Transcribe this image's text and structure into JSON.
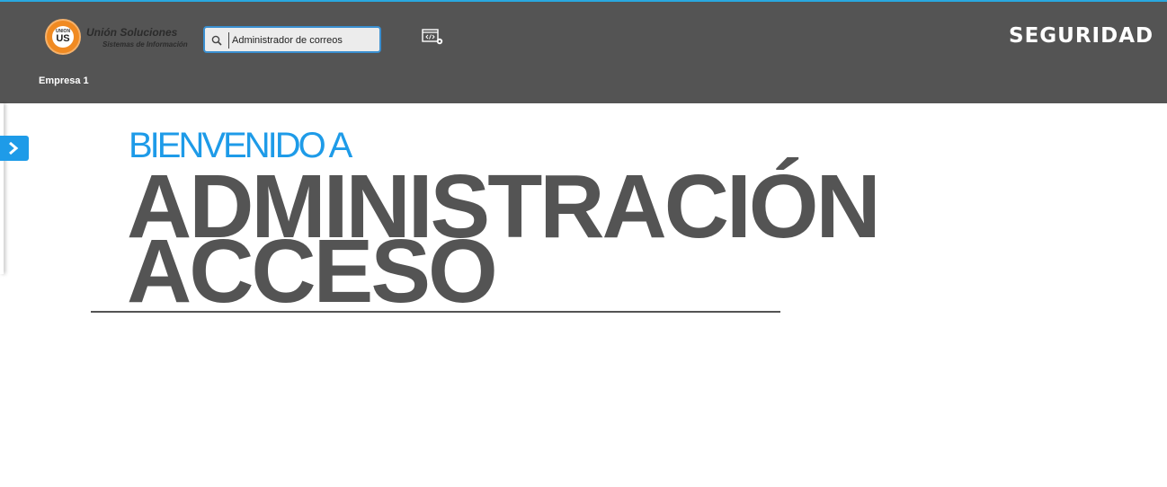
{
  "header": {
    "logo": {
      "badge_small": "UNION",
      "badge_big": "US",
      "name": "Unión Soluciones",
      "subtitle": "Sistemas de Información"
    },
    "search": {
      "value": "Administrador de correos",
      "icon": "search-icon"
    },
    "code_settings_icon": "code-settings-icon",
    "brand": "SEGURIDAD",
    "company": "Empresa 1",
    "colors": {
      "background": "#545454",
      "accent": "#1e9be8",
      "logo_orange": "#f08a22"
    }
  },
  "sidebar": {
    "toggle_icon": "chevron-right-icon"
  },
  "main": {
    "welcome": "BIENVENIDO A",
    "title_line1": "ADMINISTRACIÓN",
    "title_line2": "ACCESO"
  }
}
